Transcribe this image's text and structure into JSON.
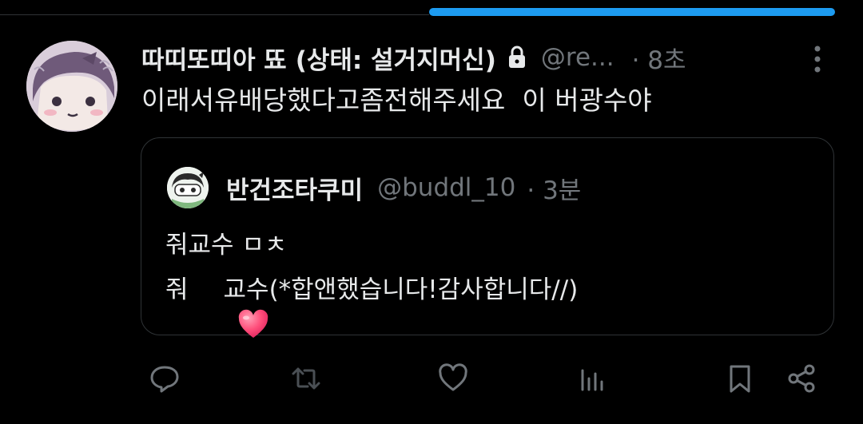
{
  "tweet": {
    "display_name": "따띠또띠아 뚀 (상태: 설거지머신)",
    "handle": "@re...",
    "time": "· 8초",
    "text": "이래서유배당했다고좀전해주세요  이 버광수야",
    "icons": {
      "lock": "lock-icon",
      "more": "more-vertical-icon"
    }
  },
  "quote": {
    "display_name": "반건조타쿠미",
    "handle": "@buddl_10",
    "time": "· 3분",
    "line1": "줘교수 ㅁㅊ",
    "line2_prefix": "줘",
    "line2_suffix": "교수(*합앤했습니다!감사합니다//)",
    "emoji": "heart-emoji"
  },
  "actions": [
    {
      "name": "reply",
      "icon": "reply-icon"
    },
    {
      "name": "retweet",
      "icon": "retweet-icon"
    },
    {
      "name": "like",
      "icon": "heart-icon"
    },
    {
      "name": "views",
      "icon": "views-icon"
    },
    {
      "name": "bookmark",
      "icon": "bookmark-icon"
    },
    {
      "name": "share",
      "icon": "share-icon"
    }
  ],
  "colors": {
    "background": "#000000",
    "text_primary": "#e7e9ea",
    "text_secondary": "#71767b",
    "accent": "#1d9bf0",
    "border": "#2f3336",
    "heart_emoji": "#ff4f7b"
  }
}
